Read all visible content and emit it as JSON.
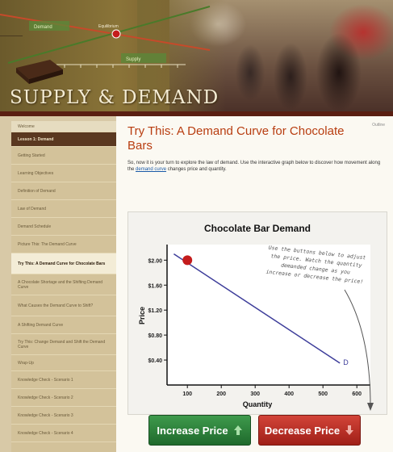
{
  "banner": {
    "site_title": "SUPPLY & DEMAND",
    "equilibrium_label": "Equilibrium",
    "demand_tag": "Demand",
    "supply_tag": "Supply"
  },
  "sidebar": {
    "items": [
      {
        "label": "Welcome",
        "kind": "welcome"
      },
      {
        "label": "Lesson 1: Demand",
        "kind": "section"
      },
      {
        "label": "Getting Started",
        "kind": "normal"
      },
      {
        "label": "Learning Objectives",
        "kind": "normal"
      },
      {
        "label": "Definition of Demand",
        "kind": "normal"
      },
      {
        "label": "Law of Demand",
        "kind": "normal"
      },
      {
        "label": "Demand Schedule",
        "kind": "normal"
      },
      {
        "label": "Picture This: The Demand Curve",
        "kind": "normal"
      },
      {
        "label": "Try This: A Demand Curve for Chocolate Bars",
        "kind": "active"
      },
      {
        "label": "A Chocolate Shortage and the Shifting Demand Curve",
        "kind": "normal"
      },
      {
        "label": "What Causes the Demand Curve to Shift?",
        "kind": "normal"
      },
      {
        "label": "A Shifting Demand Curve",
        "kind": "normal"
      },
      {
        "label": "Try This: Change Demand and Shift the Demand Curve",
        "kind": "normal"
      },
      {
        "label": "Wrap-Up",
        "kind": "normal"
      },
      {
        "label": "Knowledge Check - Scenario 1",
        "kind": "normal"
      },
      {
        "label": "Knowledge Check - Scenario 2",
        "kind": "normal"
      },
      {
        "label": "Knowledge Check - Scenario 3",
        "kind": "normal"
      },
      {
        "label": "Knowledge Check - Scenario 4",
        "kind": "normal"
      }
    ]
  },
  "main": {
    "outline_link": "Outline",
    "title": "Try This: A Demand Curve for Chocolate Bars",
    "intro_prefix": "So, now it is your turn to explore the law of demand. Use the interactive graph below to discover how movement along the ",
    "intro_link": "demand curve",
    "intro_suffix": " changes price and quantity.",
    "annotation_lines": [
      "Use the buttons below to adjust",
      "the price. Watch the quantity",
      "demanded change as you",
      "increase or decrease the price!"
    ],
    "increase_label": "Increase Price",
    "decrease_label": "Decrease Price"
  },
  "colors": {
    "title": "#b83d10",
    "increase": "#2a7f39",
    "decrease": "#c0312a",
    "demand_line": "#3d3d9a",
    "point": "#c41c1c"
  },
  "chart_data": {
    "type": "line",
    "title": "Chocolate Bar Demand",
    "xlabel": "Quantity",
    "ylabel": "Price",
    "x_ticks": [
      100,
      200,
      300,
      400,
      500,
      600
    ],
    "y_ticks": [
      "$0.40",
      "$0.80",
      "$1.20",
      "$1.60",
      "$2.00"
    ],
    "y_tick_values": [
      0.4,
      0.8,
      1.2,
      1.6,
      2.0
    ],
    "xlim": [
      40,
      640
    ],
    "ylim": [
      0,
      2.25
    ],
    "series": [
      {
        "name": "D",
        "x": [
          60,
          550
        ],
        "y": [
          2.1,
          0.35
        ]
      }
    ],
    "current_point": {
      "x": 100,
      "y": 2.0
    }
  }
}
